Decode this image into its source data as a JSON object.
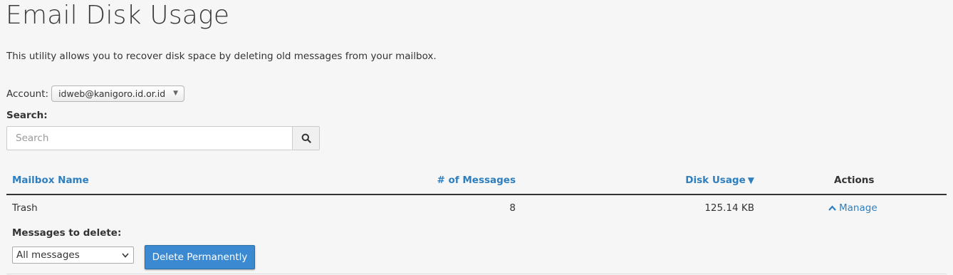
{
  "header": {
    "title": "Email Disk Usage",
    "description": "This utility allows you to recover disk space by deleting old messages from your mailbox."
  },
  "account": {
    "label": "Account:",
    "selected": "idweb@kanigoro.id.or.id"
  },
  "search": {
    "label": "Search:",
    "placeholder": "Search",
    "icon": "search-icon"
  },
  "table": {
    "columns": {
      "mailbox": "Mailbox Name",
      "messages": "# of Messages",
      "disk_usage": "Disk Usage",
      "actions": "Actions"
    },
    "sort": {
      "column": "disk_usage",
      "direction": "descending"
    },
    "rows": [
      {
        "name": "Trash",
        "count": "8",
        "size": "125.14 KB",
        "action": "Manage"
      }
    ]
  },
  "manage_panel": {
    "label": "Messages to delete:",
    "selected_option": "All messages",
    "delete_label": "Delete Permanently"
  },
  "colors": {
    "link": "#2e7fc0",
    "primary_button": "#3b89d0",
    "background": "#f6f6f6"
  }
}
